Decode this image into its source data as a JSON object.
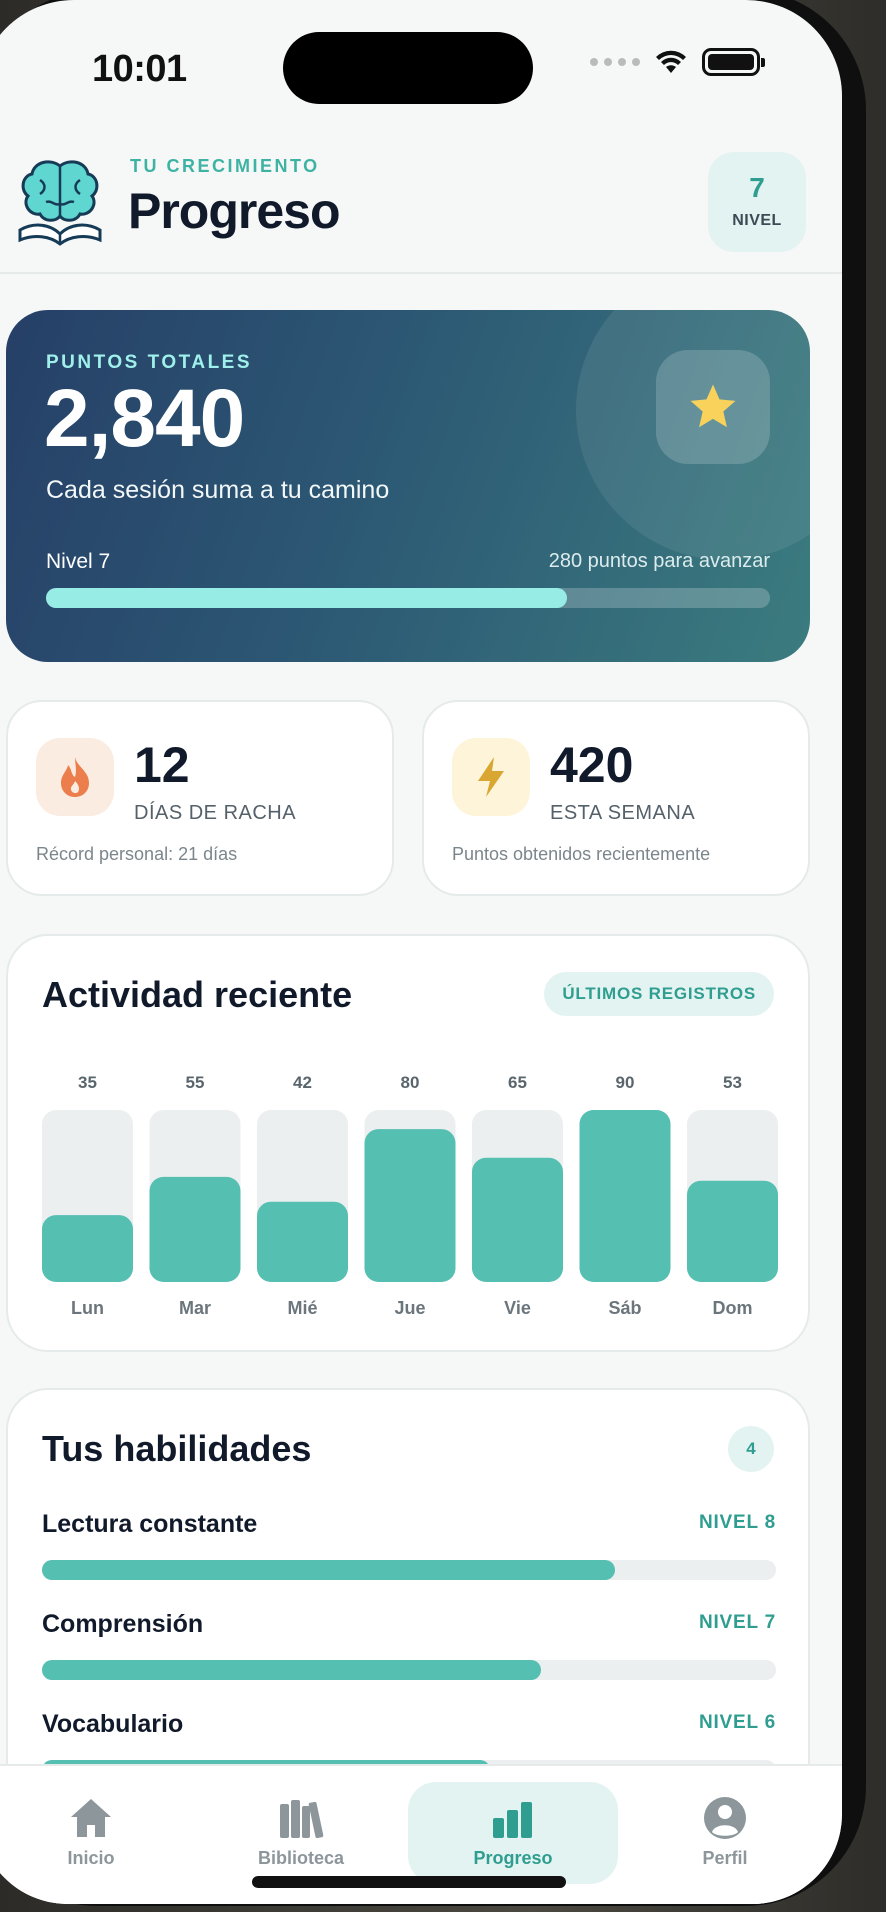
{
  "status_bar": {
    "time": "10:01"
  },
  "header": {
    "eyebrow": "TU CRECIMIENTO",
    "title": "Progreso",
    "level_chip": {
      "value": "7",
      "label": "NIVEL"
    }
  },
  "hero": {
    "label": "PUNTOS TOTALES",
    "points": "2,840",
    "tagline": "Cada sesión suma a tu camino",
    "level_label": "Nivel 7",
    "advance_text": "280 puntos para avanzar",
    "progress_fraction": 0.72,
    "icon": "star-icon"
  },
  "stats": {
    "streak": {
      "value": "12",
      "label": "DÍAS DE RACHA",
      "note": "Récord personal: 21 días",
      "icon": "flame-icon"
    },
    "week": {
      "value": "420",
      "label": "ESTA SEMANA",
      "note": "Puntos obtenidos recientemente",
      "icon": "bolt-icon"
    }
  },
  "activity": {
    "title": "Actividad reciente",
    "pill": "ÚLTIMOS REGISTROS"
  },
  "chart_data": {
    "type": "bar",
    "categories": [
      "Lun",
      "Mar",
      "Mié",
      "Jue",
      "Vie",
      "Sáb",
      "Dom"
    ],
    "values": [
      35,
      55,
      42,
      80,
      65,
      90,
      53
    ],
    "ylim": [
      0,
      90
    ]
  },
  "skills": {
    "title": "Tus habilidades",
    "count": "4",
    "items": [
      {
        "name": "Lectura constante",
        "level": "NIVEL 8",
        "progress": 0.78
      },
      {
        "name": "Comprensión",
        "level": "NIVEL 7",
        "progress": 0.68
      },
      {
        "name": "Vocabulario",
        "level": "NIVEL 6",
        "progress": 0.61
      }
    ]
  },
  "tabbar": {
    "items": [
      {
        "label": "Inicio",
        "icon": "home-icon"
      },
      {
        "label": "Biblioteca",
        "icon": "books-icon"
      },
      {
        "label": "Progreso",
        "icon": "bar-chart-icon"
      },
      {
        "label": "Perfil",
        "icon": "person-icon"
      }
    ],
    "active": "Progreso"
  },
  "colors": {
    "accent": "#2f9e90",
    "bar": "#55bfb2",
    "bar_track": "#eceff0",
    "hero_start": "#263f67",
    "hero_end": "#3b7c7f"
  }
}
